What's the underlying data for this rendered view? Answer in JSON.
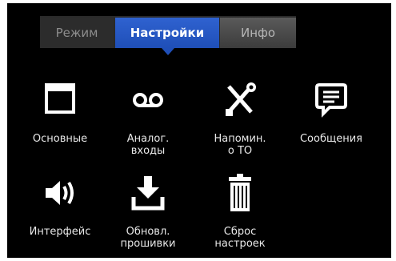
{
  "tabs": {
    "mode": "Режим",
    "settings": "Настройки",
    "info": "Инфо"
  },
  "settings": {
    "items": [
      {
        "label": "Основные",
        "icon": "window-icon"
      },
      {
        "label": "Аналог.\nвходы",
        "icon": "voicemail-icon"
      },
      {
        "label": "Напомин.\nо ТО",
        "icon": "tools-icon"
      },
      {
        "label": "Сообщения",
        "icon": "message-icon"
      },
      {
        "label": "Интерфейс",
        "icon": "speaker-icon"
      },
      {
        "label": "Обновл.\nпрошивки",
        "icon": "download-icon"
      },
      {
        "label": "Сброс\nнастроек",
        "icon": "trash-icon"
      }
    ]
  },
  "colors": {
    "background": "#000000",
    "active_tab": "#1f4fb8",
    "icon": "#ffffff"
  }
}
